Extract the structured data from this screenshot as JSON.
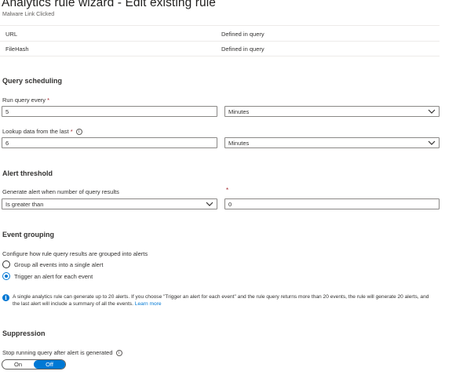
{
  "header": {
    "title": "Analytics rule wizard - Edit existing rule",
    "subtitle": "Malware Link Clicked"
  },
  "entity_rows": [
    {
      "name": "URL",
      "value": "Defined in query"
    },
    {
      "name": "FileHash",
      "value": "Defined in query"
    }
  ],
  "query_scheduling": {
    "heading": "Query scheduling",
    "run_every": {
      "label": "Run query every",
      "required_mark": "*",
      "value": "5",
      "unit": "Minutes"
    },
    "lookup": {
      "label": "Lookup data from the last",
      "required_mark": "*",
      "value": "6",
      "unit": "Minutes",
      "info_icon": "i"
    }
  },
  "alert_threshold": {
    "heading": "Alert threshold",
    "label": "Generate alert when number of query results",
    "required_mark": "*",
    "operator": "Is greater than",
    "value": "0"
  },
  "event_grouping": {
    "heading": "Event grouping",
    "label": "Configure how rule query results are grouped into alerts",
    "options": [
      {
        "label": "Group all events into a single alert",
        "checked": false
      },
      {
        "label": "Trigger an alert for each event",
        "checked": true
      }
    ],
    "note_icon": "i",
    "note_text": "A single analytics rule can generate up to 20 alerts. If you choose \"Trigger an alert for each event\" and the rule query returns more than 20 events, the rule will generate 20 alerts, and the last alert will include a summary of all the events.",
    "note_link": "Learn more"
  },
  "suppression": {
    "heading": "Suppression",
    "label": "Stop running query after alert is generated",
    "info_icon": "i",
    "toggle_on": "On",
    "toggle_off": "Off",
    "selected": "Off"
  },
  "colors": {
    "accent": "#0078d4",
    "required": "#a4262c",
    "divider": "#edebe9"
  }
}
